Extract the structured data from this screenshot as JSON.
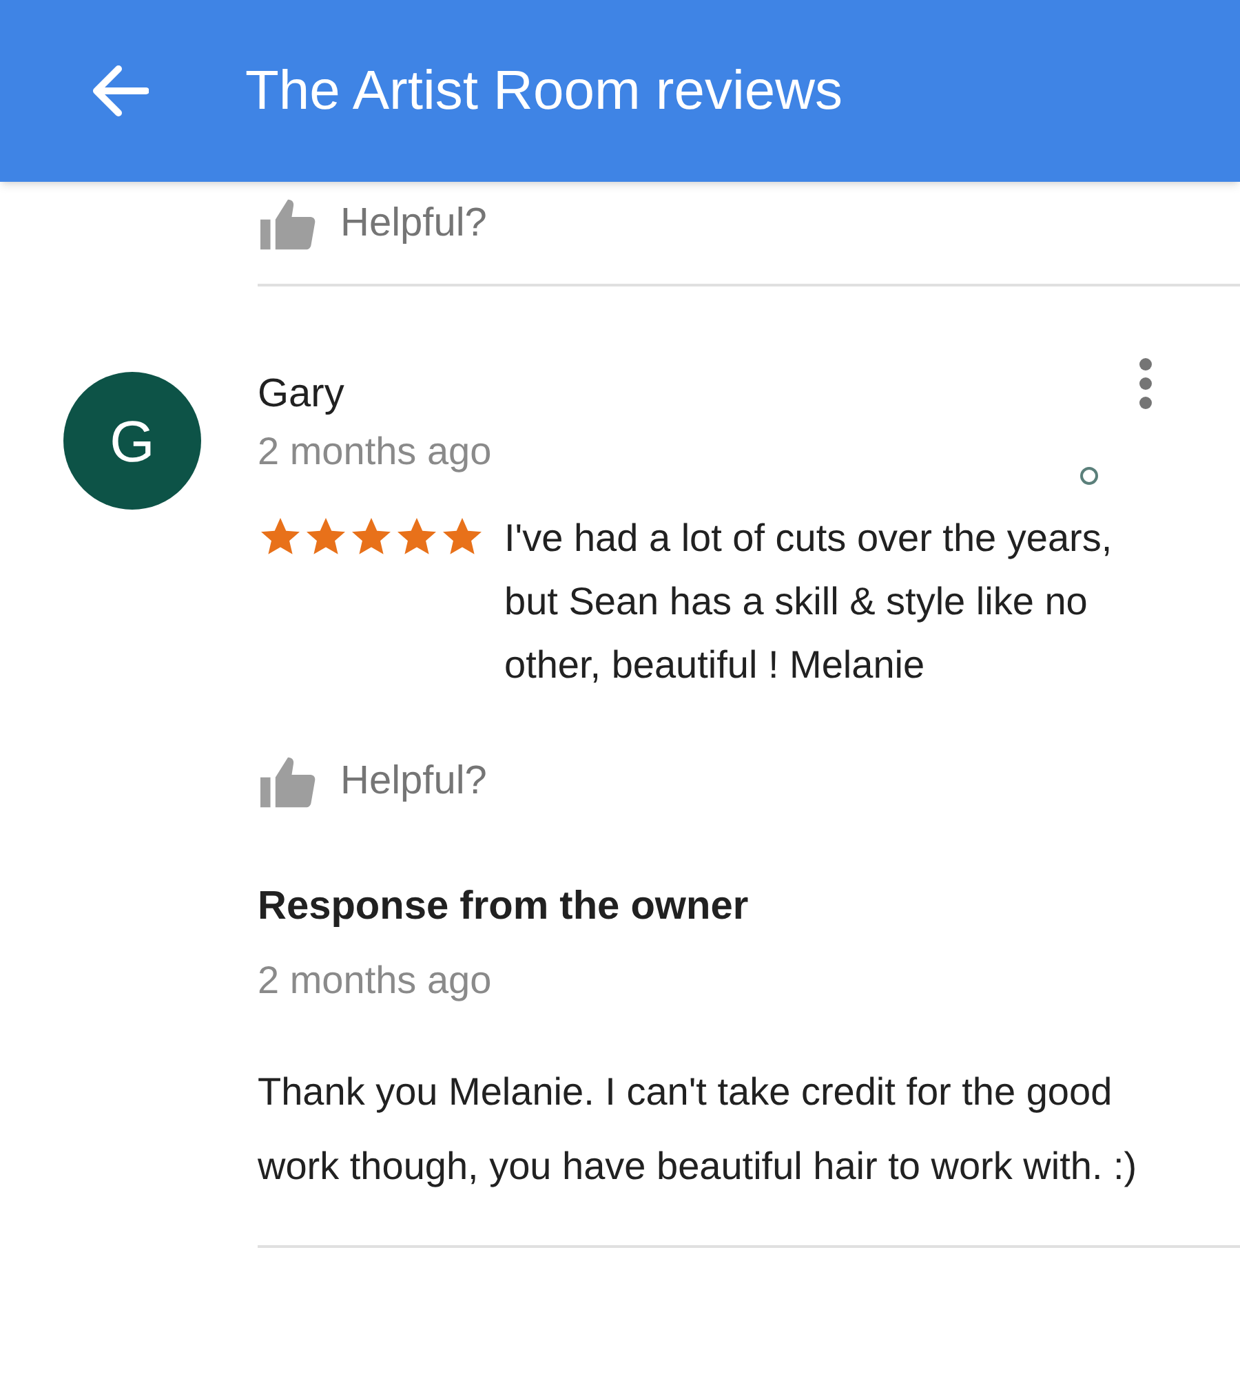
{
  "app_bar": {
    "title": "The Artist Room reviews"
  },
  "previous_review": {
    "helpful_label": "Helpful?"
  },
  "review": {
    "avatar_letter": "G",
    "author": "Gary",
    "time": "2 months ago",
    "stars": 5,
    "text": "I've had a lot of cuts over the years, but Sean has a skill & style like no other, beautiful ! Melanie",
    "helpful_label": "Helpful?",
    "owner_response": {
      "heading": "Response from the owner",
      "time": "2 months ago",
      "text": "Thank you Melanie. I can't take credit for the good work though, you have beautiful hair to work with. :)"
    }
  }
}
